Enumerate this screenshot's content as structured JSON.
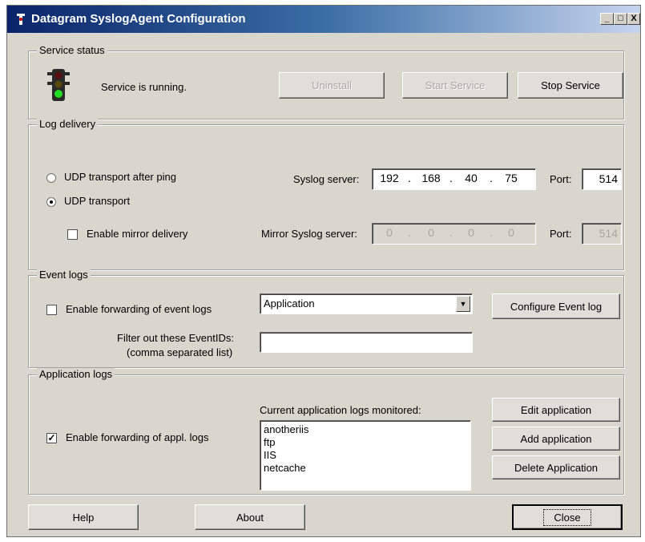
{
  "window": {
    "title": "Datagram SyslogAgent Configuration",
    "controls": {
      "minimize": "_",
      "maximize": "□",
      "close": "X"
    }
  },
  "service_status": {
    "label": "Service status",
    "status_text": "Service is running.",
    "uninstall": "Uninstall",
    "start_service": "Start Service",
    "stop_service": "Stop Service"
  },
  "log_delivery": {
    "label": "Log delivery",
    "udp_after_ping": "UDP transport after ping",
    "udp_transport": "UDP transport",
    "enable_mirror": "Enable mirror delivery",
    "syslog_server_label": "Syslog server:",
    "syslog_ip": [
      "192",
      "168",
      "40",
      "75"
    ],
    "port_label": "Port:",
    "port_value": "514",
    "mirror_label": "Mirror Syslog server:",
    "mirror_ip": [
      "0",
      "0",
      "0",
      "0"
    ],
    "mirror_port_value": "514"
  },
  "event_logs": {
    "label": "Event logs",
    "enable_forwarding": "Enable forwarding of event logs",
    "selected_log": "Application",
    "configure_button": "Configure Event log",
    "filter_label_1": "Filter out these EventIDs:",
    "filter_label_2": "(comma separated list)",
    "filter_value": ""
  },
  "application_logs": {
    "label": "Application logs",
    "current_label": "Current application logs monitored:",
    "enable_forwarding": "Enable forwarding of appl. logs",
    "items": [
      "anotheriis",
      "ftp",
      "IIS",
      "netcache"
    ],
    "edit_button": "Edit application",
    "add_button": "Add application",
    "delete_button": "Delete Application"
  },
  "footer": {
    "help": "Help",
    "about": "About",
    "close": "Close"
  },
  "colors": {
    "face": "#d9d6cd",
    "title_start": "#0a246a",
    "title_end": "#c6d4ee"
  },
  "icons": {
    "traffic_light": "traffic-light-icon",
    "app": "syslog-agent-icon"
  }
}
